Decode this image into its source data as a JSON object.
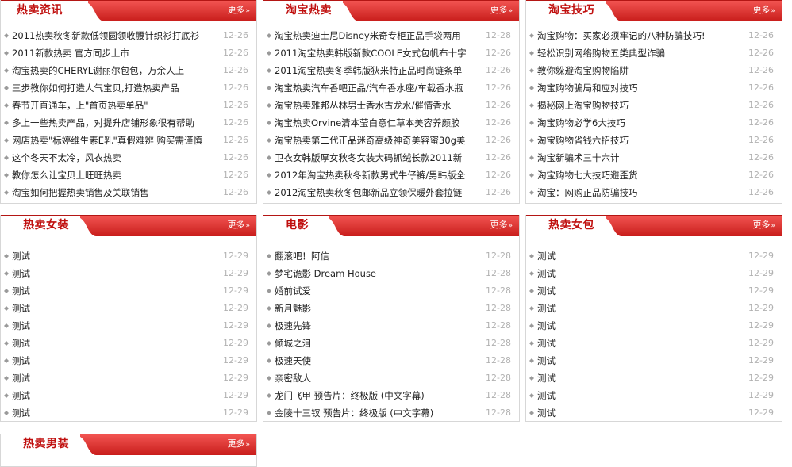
{
  "more_label": "更多",
  "more_arrow": "»",
  "panels": [
    {
      "title": "热卖资讯",
      "items": [
        {
          "text": "2011热卖秋冬新款低领圆领收腰针织衫打底衫",
          "date": "12-26"
        },
        {
          "text": "2011新款热卖 官方同步上市",
          "date": "12-26"
        },
        {
          "text": "淘宝热卖的CHERYL谢丽尔包包，万余人上",
          "date": "12-26"
        },
        {
          "text": "三步教你如何打造人气宝贝,打造热卖产品",
          "date": "12-26"
        },
        {
          "text": "春节开直通车，上\"首页热卖单品\"",
          "date": "12-26"
        },
        {
          "text": "多上一些热卖产品，对提升店铺形象很有帮助",
          "date": "12-26"
        },
        {
          "text": "网店热卖\"标婷维生素E乳\"真假难辨 购买需谨慎",
          "date": "12-26"
        },
        {
          "text": "这个冬天不太冷，风衣热卖",
          "date": "12-26"
        },
        {
          "text": "教你怎么让宝贝上旺旺热卖",
          "date": "12-26"
        },
        {
          "text": "淘宝如何把握热卖销售及关联销售",
          "date": "12-26"
        }
      ]
    },
    {
      "title": "淘宝热卖",
      "items": [
        {
          "text": "淘宝热卖迪士尼Disney米奇专柜正品手袋两用",
          "date": "12-28"
        },
        {
          "text": "2011淘宝热卖韩版新款COOLE女式包帆布十字",
          "date": "12-26"
        },
        {
          "text": "2011淘宝热卖冬季韩版狄米特正品时尚链条单",
          "date": "12-26"
        },
        {
          "text": "淘宝热卖汽车香吧正品/汽车香水座/车载香水瓶",
          "date": "12-26"
        },
        {
          "text": "淘宝热卖雅邦丛林男士香水古龙水/催情香水",
          "date": "12-26"
        },
        {
          "text": "淘宝热卖Orvine清本莹白意仁草本美容养颜胶",
          "date": "12-26"
        },
        {
          "text": "淘宝热卖第二代正品迷奇高级神奇美容蜜30g美",
          "date": "12-26"
        },
        {
          "text": "卫衣女韩版厚女秋冬女装大码抓绒长款2011新",
          "date": "12-26"
        },
        {
          "text": "2012年淘宝热卖秋冬新款男式牛仔裤/男韩版全",
          "date": "12-26"
        },
        {
          "text": "2012淘宝热卖秋冬包邮新品立领保暖外套拉链",
          "date": "12-26"
        }
      ]
    },
    {
      "title": "淘宝技巧",
      "items": [
        {
          "text": "淘宝购物：买家必须牢记的八种防骗技巧!",
          "date": "12-26"
        },
        {
          "text": "轻松识别网络购物五类典型诈骗",
          "date": "12-26"
        },
        {
          "text": "教你躲避淘宝购物陷阱",
          "date": "12-26"
        },
        {
          "text": "淘宝购物骗局和应对技巧",
          "date": "12-26"
        },
        {
          "text": "揭秘网上淘宝购物技巧",
          "date": "12-26"
        },
        {
          "text": "淘宝购物必学6大技巧",
          "date": "12-26"
        },
        {
          "text": "淘宝购物省钱六招技巧",
          "date": "12-26"
        },
        {
          "text": "淘宝新骗术三十六计",
          "date": "12-26"
        },
        {
          "text": "淘宝购物七大技巧避歪货",
          "date": "12-26"
        },
        {
          "text": "淘宝：网购正品防骗技巧",
          "date": "12-26"
        }
      ]
    },
    {
      "title": "热卖女装",
      "items": [
        {
          "text": "测试",
          "date": "12-29"
        },
        {
          "text": "测试",
          "date": "12-29"
        },
        {
          "text": "测试",
          "date": "12-29"
        },
        {
          "text": "测试",
          "date": "12-29"
        },
        {
          "text": "测试",
          "date": "12-29"
        },
        {
          "text": "测试",
          "date": "12-29"
        },
        {
          "text": "测试",
          "date": "12-29"
        },
        {
          "text": "测试",
          "date": "12-29"
        },
        {
          "text": "测试",
          "date": "12-29"
        },
        {
          "text": "测试",
          "date": "12-29"
        }
      ]
    },
    {
      "title": "电影",
      "items": [
        {
          "text": "翻滚吧！阿信",
          "date": "12-28"
        },
        {
          "text": "梦宅诡影 Dream House",
          "date": "12-28"
        },
        {
          "text": "婚前试爱",
          "date": "12-28"
        },
        {
          "text": "新月魅影",
          "date": "12-28"
        },
        {
          "text": "极速先锋",
          "date": "12-28"
        },
        {
          "text": "倾城之泪",
          "date": "12-28"
        },
        {
          "text": "极速天使",
          "date": "12-28"
        },
        {
          "text": "亲密敌人",
          "date": "12-28"
        },
        {
          "text": "龙门飞甲 预告片：终极版 (中文字幕)",
          "date": "12-28"
        },
        {
          "text": "金陵十三钗 预告片：终极版 (中文字幕)",
          "date": "12-28"
        }
      ]
    },
    {
      "title": "热卖女包",
      "items": [
        {
          "text": "测试",
          "date": "12-29"
        },
        {
          "text": "测试",
          "date": "12-29"
        },
        {
          "text": "测试",
          "date": "12-29"
        },
        {
          "text": "测试",
          "date": "12-29"
        },
        {
          "text": "测试",
          "date": "12-29"
        },
        {
          "text": "测试",
          "date": "12-29"
        },
        {
          "text": "测试",
          "date": "12-29"
        },
        {
          "text": "测试",
          "date": "12-29"
        },
        {
          "text": "测试",
          "date": "12-29"
        },
        {
          "text": "测试",
          "date": "12-29"
        }
      ]
    },
    {
      "title": "热卖男装",
      "items": []
    }
  ]
}
